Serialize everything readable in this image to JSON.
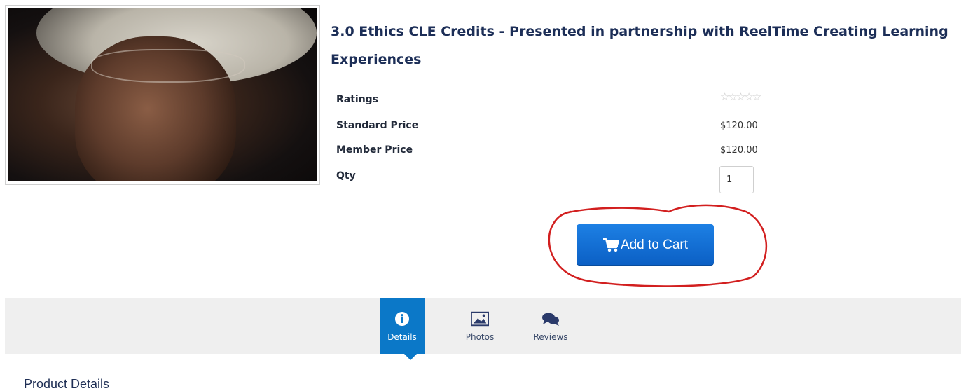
{
  "product": {
    "title_line1": "3.0 Ethics CLE Credits - Presented in partnership with ReelTime Creating Learning",
    "title_line2": "Experiences",
    "image_icon": "product-photo"
  },
  "info": {
    "ratings_label": "Ratings",
    "ratings_stars": "☆☆☆☆☆",
    "standard_price_label": "Standard Price",
    "standard_price": "$120.00",
    "member_price_label": "Member Price",
    "member_price": "$120.00",
    "qty_label": "Qty",
    "qty_value": "1"
  },
  "cart": {
    "button_label": "Add to Cart",
    "icon": "cart-icon",
    "button_color": "#0b6fd6",
    "annotation_color": "#d21f1f"
  },
  "tabs": [
    {
      "label": "Details",
      "icon": "info-icon",
      "active": true
    },
    {
      "label": "Photos",
      "icon": "image-icon",
      "active": false
    },
    {
      "label": "Reviews",
      "icon": "comments-icon",
      "active": false
    }
  ],
  "tab_active_color": "#0b78c8",
  "section": {
    "heading": "Product Details"
  }
}
